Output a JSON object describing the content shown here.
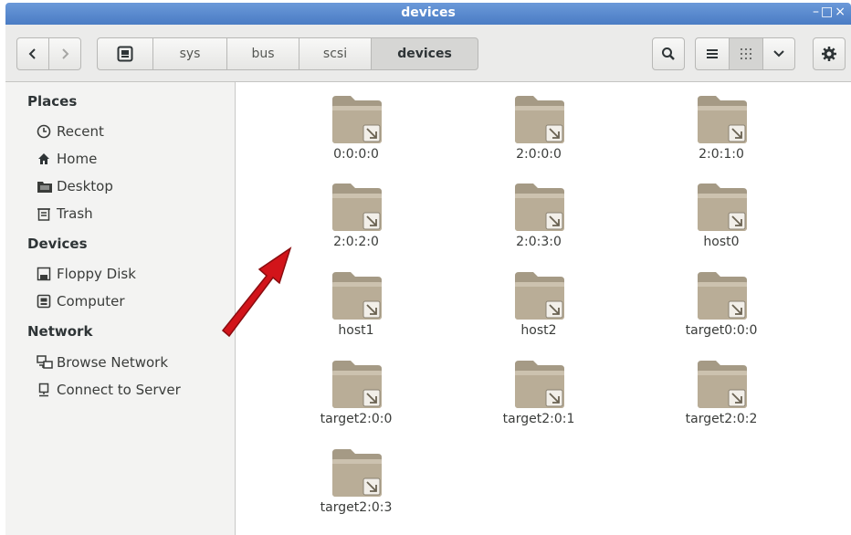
{
  "window": {
    "title": "devices"
  },
  "toolbar": {
    "path": [
      "sys",
      "bus",
      "scsi",
      "devices"
    ]
  },
  "sidebar": {
    "sections": [
      {
        "heading": "Places",
        "items": [
          {
            "label": "Recent",
            "icon": "clock-icon"
          },
          {
            "label": "Home",
            "icon": "home-icon"
          },
          {
            "label": "Desktop",
            "icon": "desktop-folder-icon"
          },
          {
            "label": "Trash",
            "icon": "trash-icon"
          }
        ]
      },
      {
        "heading": "Devices",
        "items": [
          {
            "label": "Floppy Disk",
            "icon": "floppy-icon"
          },
          {
            "label": "Computer",
            "icon": "computer-icon"
          }
        ]
      },
      {
        "heading": "Network",
        "items": [
          {
            "label": "Browse Network",
            "icon": "network-icon"
          },
          {
            "label": "Connect to Server",
            "icon": "server-icon"
          }
        ]
      }
    ]
  },
  "files": [
    "0:0:0:0",
    "2:0:0:0",
    "2:0:1:0",
    "2:0:2:0",
    "2:0:3:0",
    "host0",
    "host1",
    "host2",
    "target0:0:0",
    "target2:0:0",
    "target2:0:1",
    "target2:0:2",
    "target2:0:3"
  ],
  "colors": {
    "folder": "#b9ad97",
    "annotation_arrow": "#d2141a",
    "titlebar": "#5a8bd0"
  }
}
